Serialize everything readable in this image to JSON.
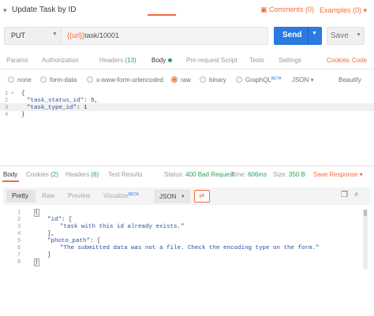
{
  "header": {
    "title": "Update Task by ID",
    "comments_label": "Comments (0)",
    "examples_label": "Examples (0)"
  },
  "request": {
    "method": "PUT",
    "url_var": "{{url}}",
    "url_path": "task/10001",
    "send_label": "Send",
    "save_label": "Save"
  },
  "req_tabs": {
    "params": "Params",
    "authorization": "Authorization",
    "headers": "Headers",
    "headers_count": "(13)",
    "body": "Body",
    "prerequest": "Pre-request Script",
    "tests": "Tests",
    "settings": "Settings",
    "cookies": "Cookies",
    "code": "Code"
  },
  "body_types": {
    "none": "none",
    "form_data": "form-data",
    "urlencoded": "x-www-form-urlencoded",
    "raw": "raw",
    "binary": "binary",
    "graphql": "GraphQL",
    "beta": "BETA",
    "format": "JSON",
    "beautify": "Beautify"
  },
  "request_body": {
    "lines": [
      "1",
      "2",
      "3",
      "4"
    ],
    "l1": "{",
    "l2_key": "\"task_status_id\"",
    "l2_val": ": 5,",
    "l3_key": "\"task_type_id\"",
    "l3_val": ": 1",
    "l4": "}"
  },
  "response_tabs": {
    "body": "Body",
    "cookies": "Cookies",
    "cookies_count": "(2)",
    "headers": "Headers",
    "headers_count": "(6)",
    "test_results": "Test Results",
    "status_label": "Status:",
    "status_value": "400 Bad Request",
    "time_label": "Time:",
    "time_value": "606ms",
    "size_label": "Size:",
    "size_value": "350 B",
    "save_response": "Save Response"
  },
  "format_bar": {
    "pretty": "Pretty",
    "raw": "Raw",
    "preview": "Preview",
    "visualize": "Visualize",
    "beta": "BETA",
    "format": "JSON"
  },
  "response_body": {
    "lines": [
      "1",
      "2",
      "3",
      "4",
      "5",
      "6",
      "7",
      "8"
    ],
    "l1": "{",
    "l2_key": "\"id\"",
    "l2_rest": ": [",
    "l3": "\"task with this id already exists.\"",
    "l4": "],",
    "l5_key": "\"photo_path\"",
    "l5_rest": ": [",
    "l6": "\"The submitted data was not a file. Check the encoding type on the form.\"",
    "l7": "]",
    "l8": "}"
  },
  "colors": {
    "accent": "#f26b3a",
    "primary": "#2a7ae2",
    "success": "#26a35a"
  },
  "icons": {
    "collapse": "chevron-down-icon",
    "comment": "comment-icon",
    "wrap": "wrap-lines-icon",
    "copy": "copy-icon",
    "search": "search-icon"
  }
}
